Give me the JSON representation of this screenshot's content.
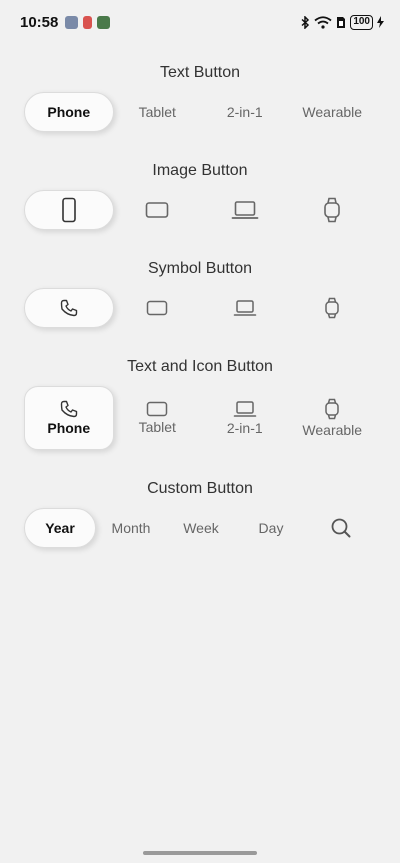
{
  "status": {
    "time": "10:58",
    "battery": "100"
  },
  "text_button": {
    "title": "Text Button",
    "items": [
      "Phone",
      "Tablet",
      "2-in-1",
      "Wearable"
    ]
  },
  "image_button": {
    "title": "Image Button",
    "icons": [
      "phone-portrait-icon",
      "tablet-icon",
      "laptop-icon",
      "watch-icon"
    ]
  },
  "symbol_button": {
    "title": "Symbol Button",
    "icons": [
      "phone-handset-icon",
      "tablet-icon",
      "laptop-icon",
      "watch-icon"
    ]
  },
  "text_icon_button": {
    "title": "Text and Icon Button",
    "items": [
      "Phone",
      "Tablet",
      "2-in-1",
      "Wearable"
    ]
  },
  "custom_button": {
    "title": "Custom Button",
    "items": [
      "Year",
      "Month",
      "Week",
      "Day"
    ]
  }
}
